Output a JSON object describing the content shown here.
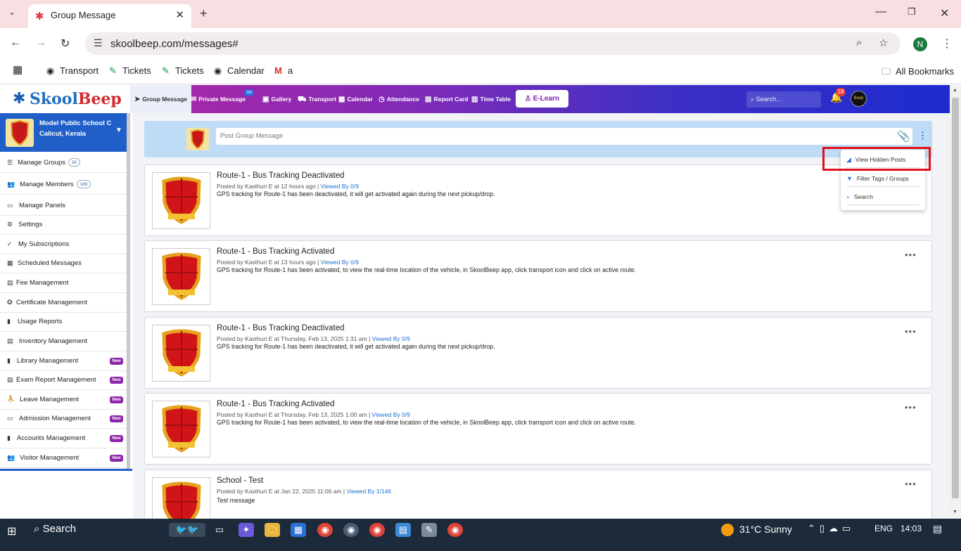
{
  "browser": {
    "tab_title": "Group Message",
    "url": "skoolbeep.com/messages#",
    "profile_initial": "N",
    "bookmarks": [
      "Transport",
      "Tickets",
      "Tickets",
      "Calendar",
      "a"
    ],
    "all_bookmarks": "All Bookmarks"
  },
  "app": {
    "logo_part1": "Skool",
    "logo_part2": "Beep",
    "nav": [
      "Group Message",
      "Private Message",
      "Gallery",
      "Transport",
      "Calendar",
      "Attendance",
      "Report Card",
      "Time Table"
    ],
    "private_badge": "189",
    "elearn": "E-Learn",
    "search_placeholder": "Search...",
    "notif_count": "18",
    "user_avatar_text": "Beep"
  },
  "sidebar": {
    "school_name": "Model Public School C",
    "school_location": "Calicut, Kerala",
    "items": [
      {
        "label": "Manage Groups",
        "count": "60"
      },
      {
        "label": "Manage Members",
        "count": "189"
      },
      {
        "label": "Manage Panels"
      },
      {
        "label": "Settings"
      },
      {
        "label": "My Subscriptions"
      },
      {
        "label": "Scheduled Messages"
      },
      {
        "label": "Fee Management"
      },
      {
        "label": "Certificate Management"
      },
      {
        "label": "Usage Reports"
      },
      {
        "label": "Inventory Management"
      },
      {
        "label": "Library Management",
        "badge": "New"
      },
      {
        "label": "Exam Report Management",
        "badge": "New"
      },
      {
        "label": "Leave Management",
        "badge": "New"
      },
      {
        "label": "Admission Management",
        "badge": "New"
      },
      {
        "label": "Accounts Management",
        "badge": "New"
      },
      {
        "label": "Visitor Management",
        "badge": "New"
      }
    ]
  },
  "composer": {
    "placeholder": "Post Group Message"
  },
  "menu": {
    "items": [
      "View Hidden Posts",
      "Filter Tags / Groups",
      "Search"
    ]
  },
  "posts": [
    {
      "title": "Route-1 - Bus Tracking Deactivated",
      "meta": "Posted by Kasthuri E at 12 hours ago",
      "viewed": "Viewed By 0/9",
      "body": "GPS tracking for Route-1 has been deactivated, it will get activated again during the next pickup/drop."
    },
    {
      "title": "Route-1 - Bus Tracking Activated",
      "meta": "Posted by Kasthuri E at 13 hours ago",
      "viewed": "Viewed By 0/9",
      "body": "GPS tracking for Route-1 has been activated, to view the real-time location of the vehicle, in SkoolBeep app, click transport icon and click on active route."
    },
    {
      "title": "Route-1 - Bus Tracking Deactivated",
      "meta": "Posted by Kasthuri E at Thursday, Feb 13, 2025 1:31 am",
      "viewed": "Viewed By 0/9",
      "body": "GPS tracking for Route-1 has been deactivated, it will get activated again during the next pickup/drop."
    },
    {
      "title": "Route-1 - Bus Tracking Activated",
      "meta": "Posted by Kasthuri E at Thursday, Feb 13, 2025 1:00 am",
      "viewed": "Viewed By 0/9",
      "body": "GPS tracking for Route-1 has been activated, to view the real-time location of the vehicle, in SkoolBeep app, click transport icon and click on active route."
    },
    {
      "title": "School - Test",
      "meta": "Posted by Kasthuri E at Jan 22, 2025 11:06 am",
      "viewed": "Viewed By 1/146",
      "body": "Test message"
    }
  ],
  "taskbar": {
    "search": "Search",
    "weather": "31°C  Sunny",
    "language": "ENG",
    "time": "14:03"
  }
}
